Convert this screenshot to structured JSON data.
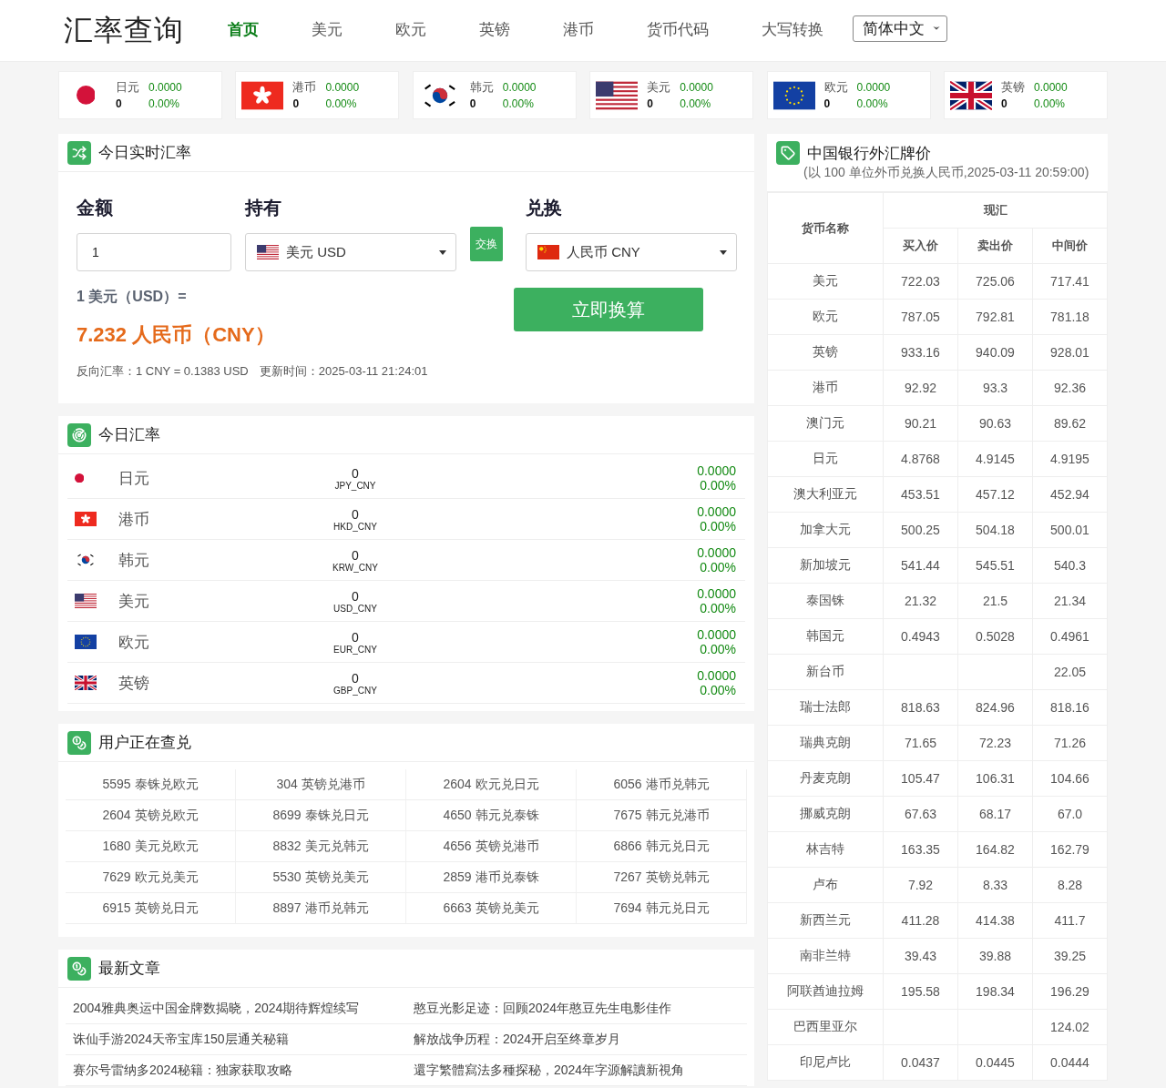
{
  "header": {
    "logo": "汇率查询",
    "nav": [
      {
        "label": "首页",
        "selected": true
      },
      {
        "label": "美元",
        "selected": false
      },
      {
        "label": "欧元",
        "selected": false
      },
      {
        "label": "英镑",
        "selected": false
      },
      {
        "label": "港币",
        "selected": false
      },
      {
        "label": "货币代码",
        "selected": false
      },
      {
        "label": "大写转换",
        "selected": false
      }
    ],
    "language": "简体中文"
  },
  "tickers": [
    {
      "kind": "jp",
      "name": "日元",
      "rate": "0",
      "value": "0.0000",
      "change": "0.00%"
    },
    {
      "kind": "hk",
      "name": "港币",
      "rate": "0",
      "value": "0.0000",
      "change": "0.00%"
    },
    {
      "kind": "kr",
      "name": "韩元",
      "rate": "0",
      "value": "0.0000",
      "change": "0.00%"
    },
    {
      "kind": "us",
      "name": "美元",
      "rate": "0",
      "value": "0.0000",
      "change": "0.00%"
    },
    {
      "kind": "eu",
      "name": "欧元",
      "rate": "0",
      "value": "0.0000",
      "change": "0.00%"
    },
    {
      "kind": "gb",
      "name": "英镑",
      "rate": "0",
      "value": "0.0000",
      "change": "0.00%"
    }
  ],
  "converter": {
    "title": "今日实时汇率",
    "amount_label": "金额",
    "from_label": "持有",
    "to_label": "兑换",
    "amount": "1",
    "from": {
      "kind": "us",
      "label": "美元 USD"
    },
    "swap": "交换",
    "to": {
      "kind": "cn",
      "label": "人民币 CNY"
    },
    "base": "1 美元（USD）=",
    "result": "7.232 人民币（CNY）",
    "convert": "立即换算",
    "reverse": "反向汇率：1 CNY = 0.1383 USD",
    "updated": "更新时间：2025-03-11 21:24:01"
  },
  "today": {
    "title": "今日汇率",
    "rows": [
      {
        "kind": "jp",
        "name": "日元",
        "rate": "0",
        "pair": "JPY_CNY",
        "value": "0.0000",
        "change": "0.00%"
      },
      {
        "kind": "hk",
        "name": "港币",
        "rate": "0",
        "pair": "HKD_CNY",
        "value": "0.0000",
        "change": "0.00%"
      },
      {
        "kind": "kr",
        "name": "韩元",
        "rate": "0",
        "pair": "KRW_CNY",
        "value": "0.0000",
        "change": "0.00%"
      },
      {
        "kind": "us",
        "name": "美元",
        "rate": "0",
        "pair": "USD_CNY",
        "value": "0.0000",
        "change": "0.00%"
      },
      {
        "kind": "eu",
        "name": "欧元",
        "rate": "0",
        "pair": "EUR_CNY",
        "value": "0.0000",
        "change": "0.00%"
      },
      {
        "kind": "gb",
        "name": "英镑",
        "rate": "0",
        "pair": "GBP_CNY",
        "value": "0.0000",
        "change": "0.00%"
      }
    ]
  },
  "queries": {
    "title": "用户正在查兑",
    "items": [
      "5595 泰铢兑欧元",
      "304 英镑兑港币",
      "2604 欧元兑日元",
      "6056 港币兑韩元",
      "2604 英镑兑欧元",
      "8699 泰铢兑日元",
      "4650 韩元兑泰铢",
      "7675 韩元兑港币",
      "1680 美元兑欧元",
      "8832 美元兑韩元",
      "4656 英镑兑港币",
      "6866 韩元兑日元",
      "7629 欧元兑美元",
      "5530 英镑兑美元",
      "2859 港币兑泰铢",
      "7267 英镑兑韩元",
      "6915 英镑兑日元",
      "8897 港币兑韩元",
      "6663 英镑兑美元",
      "7694 韩元兑日元"
    ]
  },
  "articles": {
    "title": "最新文章",
    "items": [
      "2004雅典奥运中国金牌数揭晓，2024期待辉煌续写",
      "憨豆光影足迹：回顾2024年憨豆先生电影佳作",
      "诛仙手游2024天帝宝库150层通关秘籍",
      "解放战争历程：2024开启至终章岁月",
      "赛尔号雷纳多2024秘籍：独家获取攻略",
      "還字繁體寫法多種探秘，2024年字源解讀新視角"
    ]
  },
  "boc": {
    "title": "中国银行外汇牌价",
    "subtitle": "(以 100 单位外币兑换人民币,2025-03-11 20:59:00)",
    "header_rows": [
      [
        "货币名称",
        "现汇"
      ],
      [
        "",
        "买入价",
        "卖出价",
        "中间价"
      ]
    ],
    "rows": [
      [
        "美元",
        "722.03",
        "725.06",
        "717.41"
      ],
      [
        "欧元",
        "787.05",
        "792.81",
        "781.18"
      ],
      [
        "英镑",
        "933.16",
        "940.09",
        "928.01"
      ],
      [
        "港币",
        "92.92",
        "93.3",
        "92.36"
      ],
      [
        "澳门元",
        "90.21",
        "90.63",
        "89.62"
      ],
      [
        "日元",
        "4.8768",
        "4.9145",
        "4.9195"
      ],
      [
        "澳大利亚元",
        "453.51",
        "457.12",
        "452.94"
      ],
      [
        "加拿大元",
        "500.25",
        "504.18",
        "500.01"
      ],
      [
        "新加坡元",
        "541.44",
        "545.51",
        "540.3"
      ],
      [
        "泰国铢",
        "21.32",
        "21.5",
        "21.34"
      ],
      [
        "韩国元",
        "0.4943",
        "0.5028",
        "0.4961"
      ],
      [
        "新台币",
        null,
        null,
        "22.05"
      ],
      [
        "瑞士法郎",
        "818.63",
        "824.96",
        "818.16"
      ],
      [
        "瑞典克朗",
        "71.65",
        "72.23",
        "71.26"
      ],
      [
        "丹麦克朗",
        "105.47",
        "106.31",
        "104.66"
      ],
      [
        "挪威克朗",
        "67.63",
        "68.17",
        "67.0"
      ],
      [
        "林吉特",
        "163.35",
        "164.82",
        "162.79"
      ],
      [
        "卢布",
        "7.92",
        "8.33",
        "8.28"
      ],
      [
        "新西兰元",
        "411.28",
        "414.38",
        "411.7"
      ],
      [
        "南非兰特",
        "39.43",
        "39.88",
        "39.25"
      ],
      [
        "阿联酋迪拉姆",
        "195.58",
        "198.34",
        "196.29"
      ],
      [
        "巴西里亚尔",
        null,
        null,
        "124.02"
      ],
      [
        "印尼卢比",
        "0.0437",
        "0.0445",
        "0.0444"
      ]
    ]
  }
}
